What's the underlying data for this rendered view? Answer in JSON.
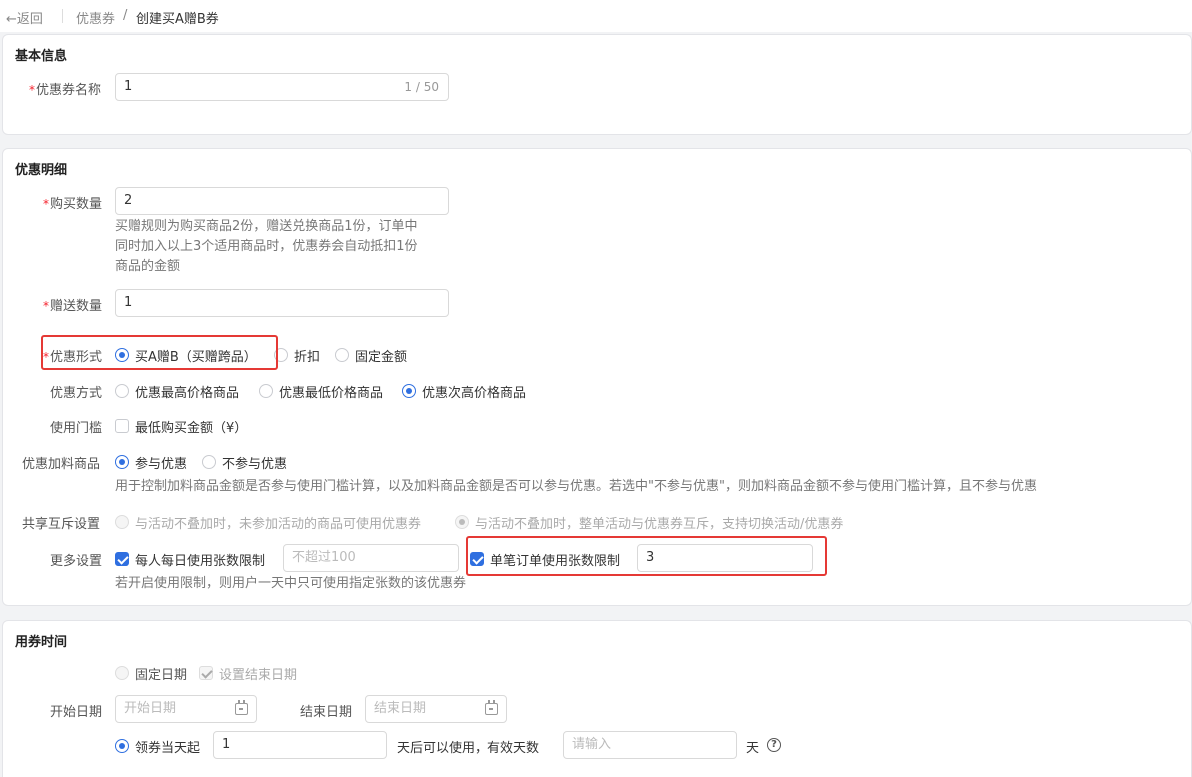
{
  "header": {
    "back_label": "返回",
    "breadcrumb_parent": "优惠券",
    "breadcrumb_sep": "/",
    "breadcrumb_current": "创建买A赠B券"
  },
  "basic": {
    "title": "基本信息",
    "name_label": "优惠券名称",
    "name_value": "1",
    "name_count": "1 / 50"
  },
  "detail": {
    "title": "优惠明细",
    "buy_qty_label": "购买数量",
    "buy_qty_value": "2",
    "buy_hint": "买赠规则为购买商品2份，赠送兑换商品1份，订单中同时加入以上3个适用商品时，优惠券会自动抵扣1份商品的金额",
    "buy_hint_lines": [
      "买赠规则为购买商品2份，赠送兑换商品1份，订单中",
      "同时加入以上3个适用商品时，优惠券会自动抵扣1份",
      "商品的金额"
    ],
    "gift_qty_label": "赠送数量",
    "gift_qty_value": "1",
    "form_label": "优惠形式",
    "form_options": [
      "买A赠B（买赠跨品）",
      "折扣",
      "固定金额"
    ],
    "form_selected": "买A赠B（买赠跨品）",
    "method_label": "优惠方式",
    "method_options": [
      "优惠最高价格商品",
      "优惠最低价格商品",
      "优惠次高价格商品"
    ],
    "method_selected": "优惠次高价格商品",
    "threshold_label": "使用门槛",
    "threshold_option": "最低购买金额（¥）",
    "addon_label": "优惠加料商品",
    "addon_options": [
      "参与优惠",
      "不参与优惠"
    ],
    "addon_selected": "参与优惠",
    "addon_hint": "用于控制加料商品金额是否参与使用门槛计算，以及加料商品金额是否可以参与优惠。若选中\"不参与优惠\"，则加料商品金额不参与使用门槛计算，且不参与优惠",
    "share_label": "共享互斥设置",
    "share_options": [
      "与活动不叠加时，未参加活动的商品可使用优惠券",
      "与活动不叠加时，整单活动与优惠券互斥，支持切换活动/优惠券"
    ],
    "share_selected": "与活动不叠加时，整单活动与优惠券互斥，支持切换活动/优惠券",
    "more_label": "更多设置",
    "daily_limit_label": "每人每日使用张数限制",
    "daily_limit_placeholder": "不超过100",
    "order_limit_label": "单笔订单使用张数限制",
    "order_limit_value": "3",
    "more_hint": "若开启使用限制，则用户一天中只可使用指定张数的该优惠券"
  },
  "time": {
    "title": "用券时间",
    "fixed_date_label": "固定日期",
    "set_end_label": "设置结束日期",
    "start_label": "开始日期",
    "start_placeholder": "开始日期",
    "end_label": "结束日期",
    "end_placeholder": "结束日期",
    "from_receive_label": "领券当天起",
    "from_receive_value": "1",
    "after_text": "天后可以使用，",
    "valid_days_label": "有效天数",
    "valid_days_placeholder": "请输入",
    "day_unit": "天",
    "help_icon": "question-circle-icon"
  },
  "colors": {
    "accent": "#2f6fe0",
    "highlight_box": "#e53935",
    "required": "#f5222d"
  }
}
